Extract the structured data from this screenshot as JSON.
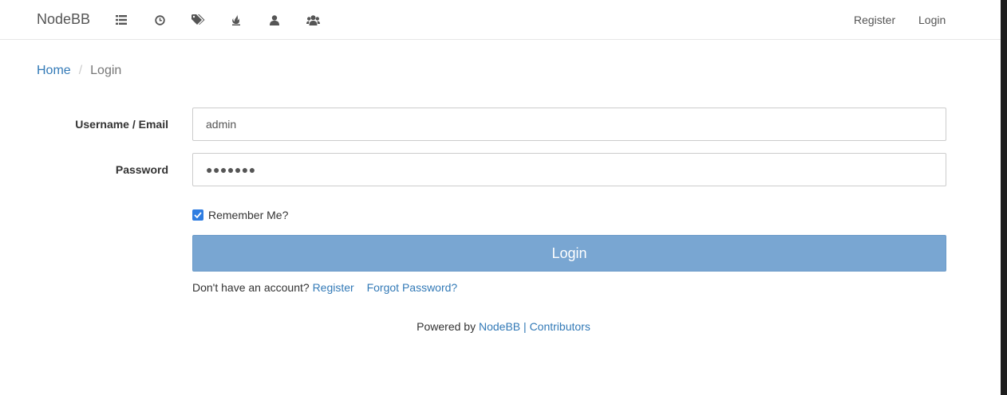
{
  "navbar": {
    "brand": "NodeBB",
    "icons": [
      "list-icon",
      "clock-icon",
      "tags-icon",
      "fire-icon",
      "user-icon",
      "users-icon"
    ],
    "register": "Register",
    "login": "Login"
  },
  "breadcrumb": {
    "home": "Home",
    "separator": "/",
    "current": "Login"
  },
  "form": {
    "username_label": "Username / Email",
    "username_value": "admin",
    "password_label": "Password",
    "password_value": "●●●●●●●",
    "remember_label": "Remember Me?",
    "remember_checked": true,
    "login_button": "Login"
  },
  "account": {
    "prompt": "Don't have an account?",
    "register_link": "Register",
    "forgot_link": "Forgot Password?"
  },
  "footer": {
    "powered_by": "Powered by",
    "nodebb_link": "NodeBB",
    "separator": "|",
    "contributors_link": "Contributors"
  },
  "colors": {
    "link": "#337ab7",
    "button": "#79a6d2",
    "checkbox": "#2f7de1"
  }
}
